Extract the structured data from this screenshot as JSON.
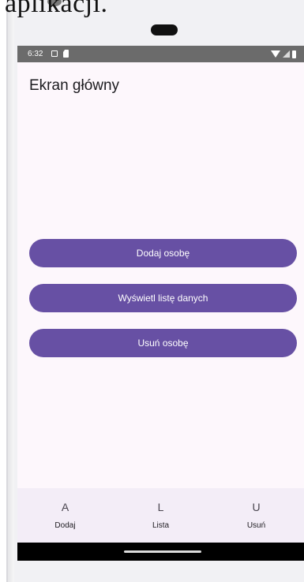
{
  "caption": {
    "fragment": "aplikacji."
  },
  "status_bar": {
    "time": "6:32",
    "icons": [
      "screen-icon",
      "sd-card-icon",
      "wifi-icon",
      "signal-icon",
      "battery-icon"
    ]
  },
  "screen": {
    "title": "Ekran główny"
  },
  "buttons": {
    "add": "Dodaj osobę",
    "list": "Wyświetl listę danych",
    "remove": "Usuń osobę"
  },
  "bottom_nav": {
    "items": [
      {
        "icon": "A",
        "label": "Dodaj"
      },
      {
        "icon": "L",
        "label": "Lista"
      },
      {
        "icon": "U",
        "label": "Usuń"
      }
    ]
  },
  "colors": {
    "primary": "#6750a4",
    "screen_bg": "#fdf7fc",
    "nav_bg": "#f3edf7",
    "status_bar": "#6b6b6b"
  }
}
